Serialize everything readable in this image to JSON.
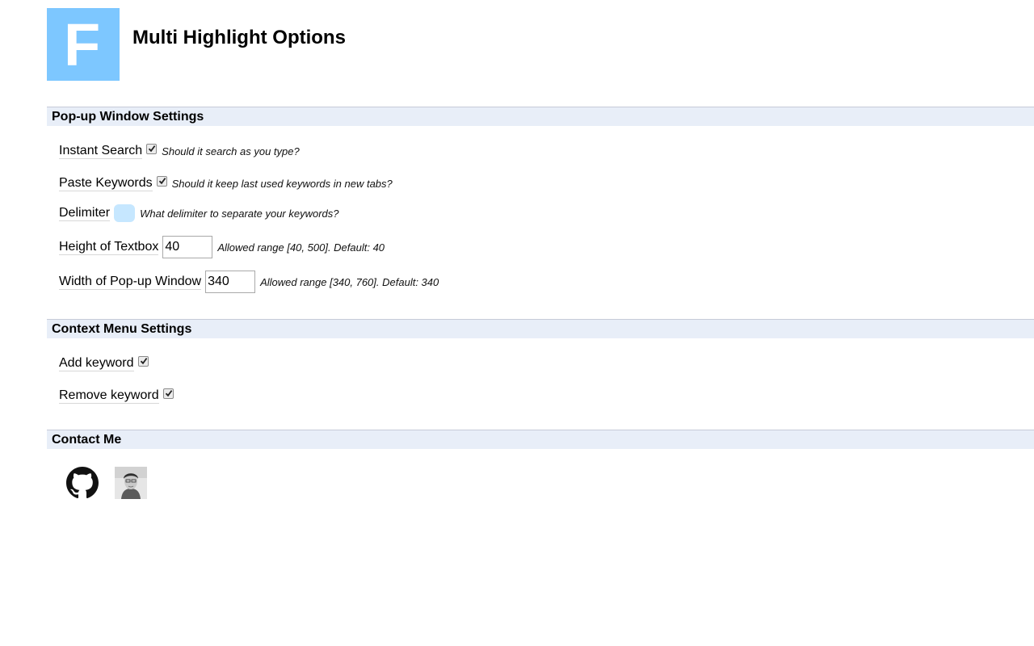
{
  "app": {
    "logo_letter": "F",
    "title": "Multi Highlight Options",
    "logo_color": "#7dc7ff",
    "section_bg_color": "#e8eef8"
  },
  "popup": {
    "header": "Pop-up Window Settings",
    "instant_search": {
      "label": "Instant Search",
      "checked": true,
      "hint": "Should it search as you type?"
    },
    "paste_keywords": {
      "label": "Paste Keywords",
      "checked": true,
      "hint": "Should it keep last used keywords in new tabs?"
    },
    "delimiter": {
      "label": "Delimiter",
      "value": "",
      "hint": "What delimiter to separate your keywords?"
    },
    "textbox_height": {
      "label": "Height of Textbox",
      "value": "40",
      "hint": "Allowed range [40, 500]. Default: 40"
    },
    "popup_width": {
      "label": "Width of Pop-up Window",
      "value": "340",
      "hint": "Allowed range [340, 760]. Default: 340"
    }
  },
  "context_menu": {
    "header": "Context Menu Settings",
    "add_keyword": {
      "label": "Add keyword",
      "checked": true
    },
    "remove_keyword": {
      "label": "Remove keyword",
      "checked": true
    }
  },
  "contact": {
    "header": "Contact Me",
    "icons": [
      "github-icon",
      "avatar-photo"
    ]
  }
}
